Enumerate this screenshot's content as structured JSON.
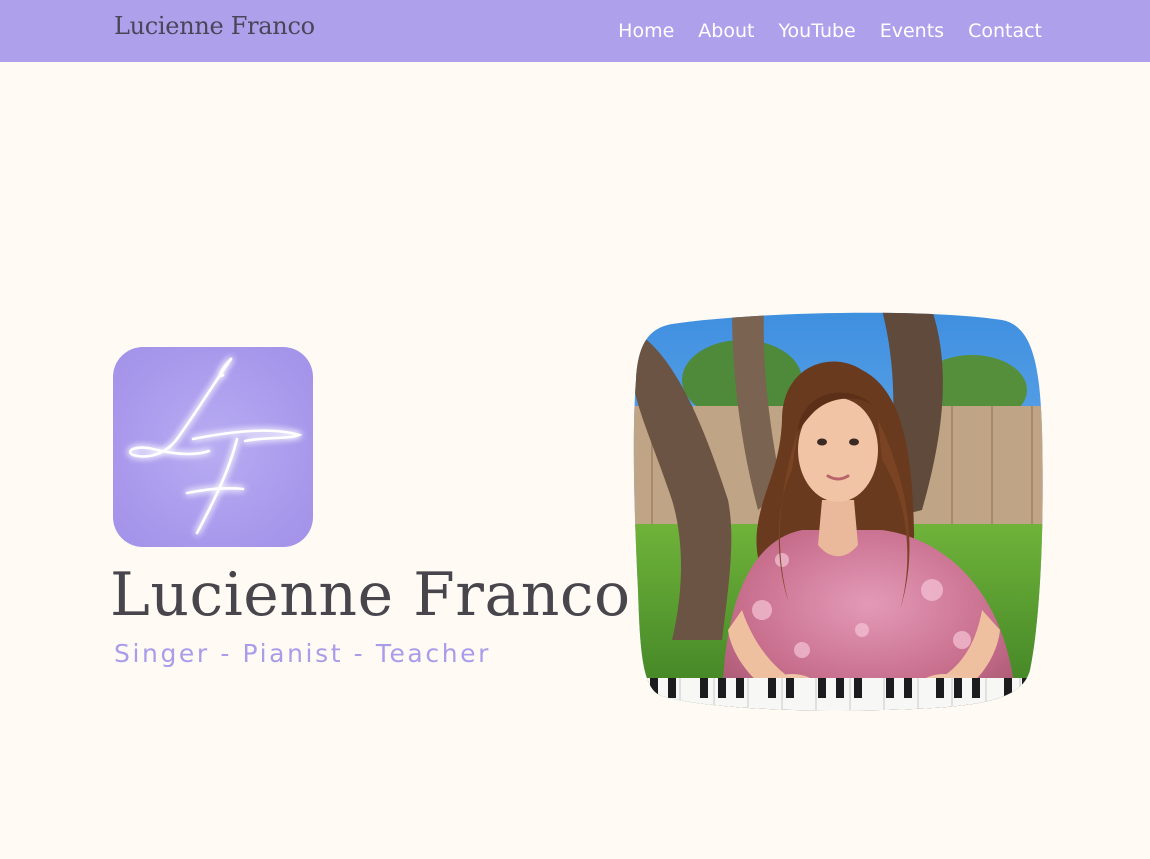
{
  "header": {
    "brand": "Lucienne Franco",
    "nav": [
      {
        "label": "Home"
      },
      {
        "label": "About"
      },
      {
        "label": "YouTube"
      },
      {
        "label": "Events"
      },
      {
        "label": "Contact"
      }
    ]
  },
  "hero": {
    "logo_icon": "lf-monogram-icon",
    "name": "Lucienne Franco",
    "tagline": "Singer - Pianist - Teacher",
    "photo_icon": "portrait-photo"
  },
  "colors": {
    "nav_background": "#afa0ec",
    "page_background": "#fffbf4",
    "accent": "#a99cea",
    "heading": "#48464c"
  }
}
